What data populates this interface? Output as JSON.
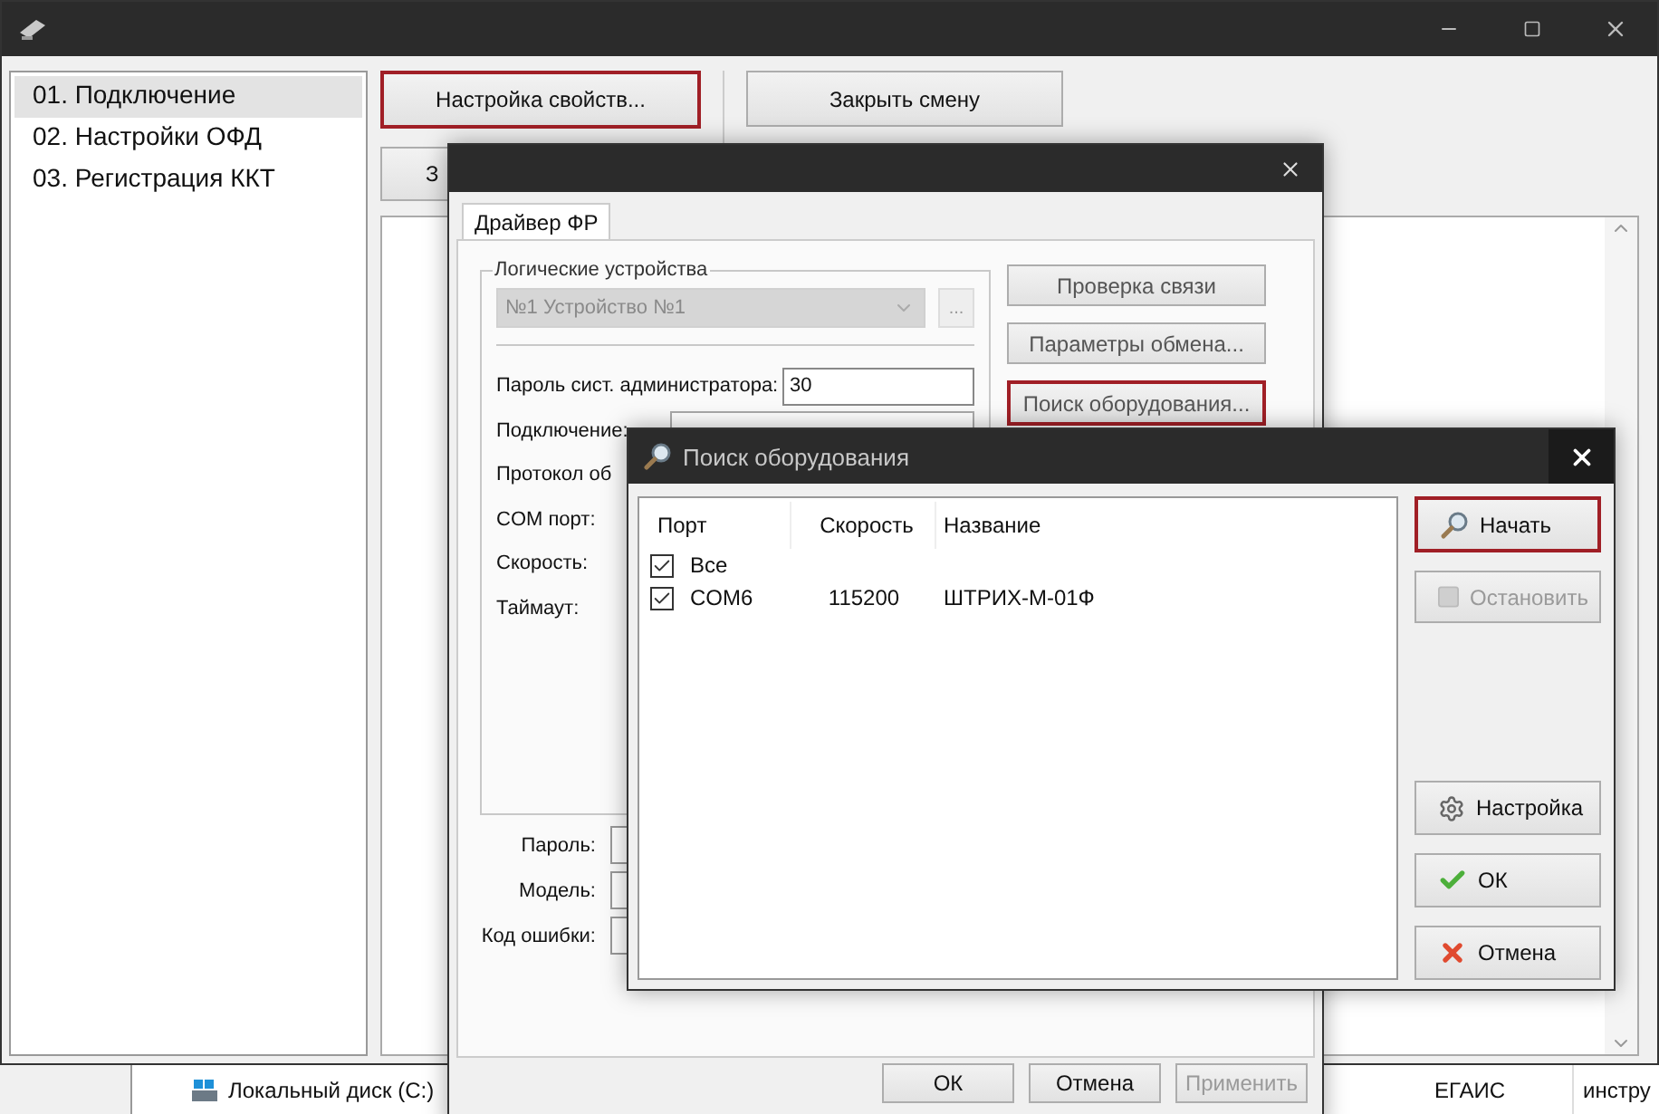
{
  "main_window": {
    "list_items": [
      {
        "label": "01. Подключение",
        "selected": true
      },
      {
        "label": "02. Настройки ОФД",
        "selected": false
      },
      {
        "label": "03. Регистрация ККТ",
        "selected": false
      }
    ],
    "buttons": [
      {
        "label": "Настройка свойств...",
        "highlighted": true
      },
      {
        "label": "З",
        "highlighted": false
      },
      {
        "label": "Закрыть смену",
        "highlighted": false
      }
    ]
  },
  "background_window": {
    "drive": "Локальный диск (C:)",
    "column_1": "ЕГАИС",
    "column_2": "инстру"
  },
  "driver_dialog": {
    "tabs": [
      {
        "label": "Драйвер ФР",
        "selected": true
      }
    ],
    "group_title": "Логические устройства",
    "device": "№1 Устройство №1",
    "browse_button": "...",
    "fields": [
      {
        "kind": "input",
        "label": "Пароль сист. администратора:",
        "value": "30"
      },
      {
        "kind": "combo",
        "label": "Подключение:"
      },
      {
        "kind": "label",
        "label": "Протокол об"
      },
      {
        "kind": "label",
        "label": "COM порт:"
      },
      {
        "kind": "label",
        "label": "Скорость:"
      },
      {
        "kind": "label",
        "label": "Таймаут:"
      }
    ],
    "side_buttons": [
      {
        "label": "Проверка связи",
        "highlighted": false
      },
      {
        "label": "Параметры обмена...",
        "highlighted": false
      },
      {
        "label": "Поиск оборудования...",
        "highlighted": true
      }
    ],
    "status_fields": [
      {
        "label": "Пароль:"
      },
      {
        "label": "Модель:"
      },
      {
        "label": "Код ошибки:"
      }
    ],
    "footer_buttons": [
      {
        "label": "ОК",
        "disabled": false
      },
      {
        "label": "Отмена",
        "disabled": false
      },
      {
        "label": "Применить",
        "disabled": true
      }
    ]
  },
  "search_dialog": {
    "title": "Поиск оборудования",
    "columns": [
      "Порт",
      "Скорость",
      "Название"
    ],
    "rows": [
      {
        "port": "Все",
        "checked": true
      },
      {
        "port": "COM6",
        "speed": "115200",
        "name": "ШТРИХ-М-01Ф",
        "checked": true
      }
    ],
    "buttons": [
      {
        "label": "Начать",
        "kind": "search",
        "highlighted": true,
        "disabled": false
      },
      {
        "label": "Остановить",
        "kind": "stop",
        "highlighted": false,
        "disabled": true
      },
      {
        "label": "Настройка",
        "kind": "gear",
        "highlighted": false,
        "disabled": false
      },
      {
        "label": "ОК",
        "kind": "check",
        "highlighted": false,
        "disabled": false
      },
      {
        "label": "Отмена",
        "kind": "cross",
        "highlighted": false,
        "disabled": false
      }
    ]
  }
}
